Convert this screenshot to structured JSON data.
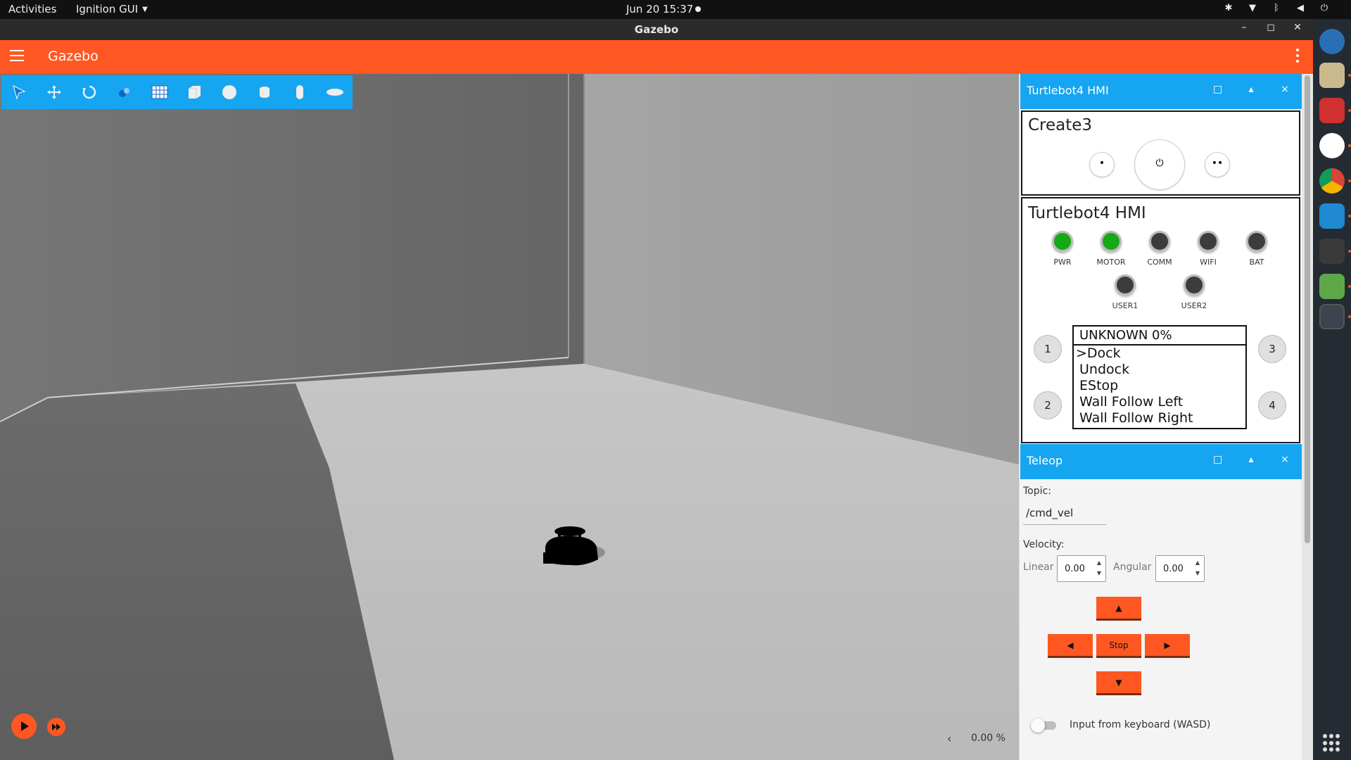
{
  "topbar": {
    "activities": "Activities",
    "app_menu": "Ignition GUI",
    "datetime": "Jun 20  15:37"
  },
  "window": {
    "title": "Gazebo"
  },
  "app_header": {
    "title": "Gazebo"
  },
  "toolbar": {
    "tools": [
      "select-icon",
      "translate-icon",
      "rotate-icon",
      "view-angle-icon",
      "grid-icon",
      "box-icon",
      "sphere-icon",
      "cylinder-icon",
      "capsule-icon",
      "ellipsoid-icon"
    ]
  },
  "scene": {
    "rtf": "0.00 %",
    "expand_arrow": "‹"
  },
  "hmi_dock": {
    "title": "Turtlebot4 HMI"
  },
  "create3": {
    "title": "Create3",
    "buttons": {
      "left": "•",
      "center": "⏻",
      "right": "••"
    }
  },
  "hmi": {
    "title": "Turtlebot4 HMI",
    "leds": [
      {
        "label": "PWR",
        "state": "on"
      },
      {
        "label": "MOTOR",
        "state": "on"
      },
      {
        "label": "COMM",
        "state": "off"
      },
      {
        "label": "WIFI",
        "state": "off"
      },
      {
        "label": "BAT",
        "state": "off"
      },
      {
        "label": "USER1",
        "state": "off"
      },
      {
        "label": "USER2",
        "state": "off"
      }
    ],
    "num_buttons": [
      "1",
      "2",
      "3",
      "4"
    ],
    "display": {
      "header": "UNKNOWN 0%",
      "menu": [
        ">Dock",
        "Undock",
        "EStop",
        "Wall Follow Left",
        "Wall Follow Right"
      ]
    }
  },
  "teleop": {
    "title": "Teleop",
    "topic_label": "Topic:",
    "topic_value": "/cmd_vel",
    "velocity_label": "Velocity:",
    "linear_label": "Linear",
    "linear_value": "0.00",
    "angular_label": "Angular",
    "angular_value": "0.00",
    "up": "▲",
    "left": "◀",
    "stop": "Stop",
    "right": "▶",
    "down": "▼",
    "keyboard_label": "Input from keyboard (WASD)"
  },
  "dock_header_buttons": {
    "float": "□",
    "collapse": "▴",
    "close": "×"
  },
  "colors": {
    "accent": "#ff5722",
    "panel_header": "#16a5f0",
    "led_on": "#15a916",
    "led_off": "#3c3c3c"
  }
}
